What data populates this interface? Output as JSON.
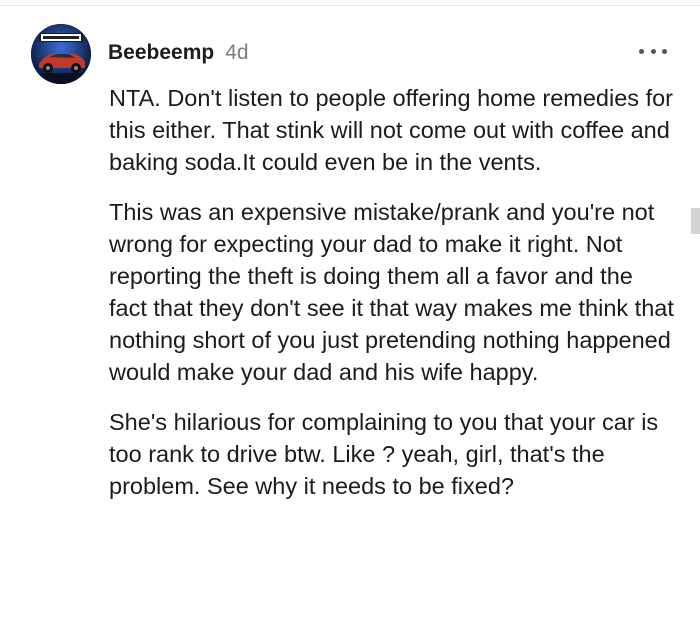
{
  "comment": {
    "username": "Beebeemp",
    "timestamp": "4d",
    "avatar_icon": "nfs-car-avatar-icon",
    "more_icon": "more-options-icon",
    "paragraphs": [
      "NTA. Don't listen to people offering home remedies for this either. That stink will not come out with coffee and baking soda.It could even be in the vents.",
      "This was an expensive mistake/prank and you're not wrong for expecting your dad to make it right. Not reporting the theft is doing them all a favor and the fact that they don't see it that way makes me think that nothing short of you just pretending nothing happened would make your dad and his wife happy.",
      "She's hilarious for complaining to you that your car is too rank to drive btw. Like ? yeah, girl, that's the problem. See why it needs to be fixed?"
    ]
  },
  "colors": {
    "text": "#1c1c1c",
    "muted": "#7c7c7c",
    "avatar_bg": "#0d1b3e"
  }
}
